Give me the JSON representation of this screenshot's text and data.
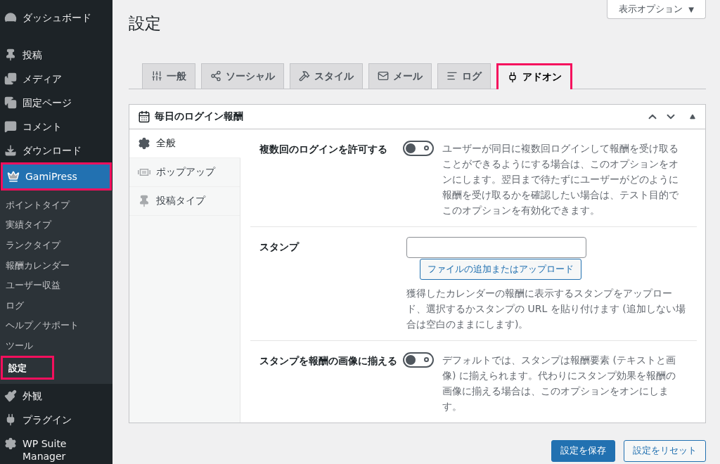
{
  "sidebar": {
    "items": [
      {
        "label": "ダッシュボード",
        "selected": false,
        "highlighted": false
      },
      {
        "label": "投稿",
        "selected": false,
        "highlighted": false
      },
      {
        "label": "メディア",
        "selected": false,
        "highlighted": false
      },
      {
        "label": "固定ページ",
        "selected": false,
        "highlighted": false
      },
      {
        "label": "コメント",
        "selected": false,
        "highlighted": false
      },
      {
        "label": "ダウンロード",
        "selected": false,
        "highlighted": false
      },
      {
        "label": "GamiPress",
        "selected": true,
        "highlighted": true,
        "children": [
          {
            "label": "ポイントタイプ",
            "selected": false,
            "highlighted": false
          },
          {
            "label": "実績タイプ",
            "selected": false,
            "highlighted": false
          },
          {
            "label": "ランクタイプ",
            "selected": false,
            "highlighted": false
          },
          {
            "label": "報酬カレンダー",
            "selected": false,
            "highlighted": false
          },
          {
            "label": "ユーザー収益",
            "selected": false,
            "highlighted": false
          },
          {
            "label": "ログ",
            "selected": false,
            "highlighted": false
          },
          {
            "label": "ヘルプ／サポート",
            "selected": false,
            "highlighted": false
          },
          {
            "label": "ツール",
            "selected": false,
            "highlighted": false
          },
          {
            "label": "設定",
            "selected": true,
            "highlighted": true
          }
        ]
      },
      {
        "label": "外観",
        "selected": false,
        "highlighted": false
      },
      {
        "label": "プラグイン",
        "selected": false,
        "highlighted": false
      },
      {
        "label": "WP Suite Manager",
        "selected": false,
        "highlighted": false
      }
    ]
  },
  "screen_options": {
    "label": "表示オプション",
    "caret": "▼"
  },
  "page_title": "設定",
  "tabs": [
    {
      "label": "一般",
      "selected": false,
      "highlighted": false
    },
    {
      "label": "ソーシャル",
      "selected": false,
      "highlighted": false
    },
    {
      "label": "スタイル",
      "selected": false,
      "highlighted": false
    },
    {
      "label": "メール",
      "selected": false,
      "highlighted": false
    },
    {
      "label": "ログ",
      "selected": false,
      "highlighted": false
    },
    {
      "label": "アドオン",
      "selected": true,
      "highlighted": true
    }
  ],
  "panel": {
    "title": "毎日のログイン報酬",
    "vertical_tabs": [
      {
        "label": "全般",
        "selected": true
      },
      {
        "label": "ポップアップ",
        "selected": false
      },
      {
        "label": "投稿タイプ",
        "selected": false
      }
    ],
    "fields": [
      {
        "kind": "toggle",
        "label": "複数回のログインを許可する",
        "on": false,
        "description": "ユーザーが同日に複数回ログインして報酬を受け取ることができるようにする場合は、このオプションをオンにします。翌日まで待たずにユーザーがどのように報酬を受け取るかを確認したい場合は、テスト目的でこのオプションを有効化できます。"
      },
      {
        "kind": "upload",
        "label": "スタンプ",
        "button": "ファイルの追加またはアップロード",
        "description": "獲得したカレンダーの報酬に表示するスタンプをアップロード、選択するかスタンプの URL を貼り付けます (追加しない場合は空白のままにします)。"
      },
      {
        "kind": "toggle",
        "label": "スタンプを報酬の画像に揃える",
        "on": false,
        "description": "デフォルトでは、スタンプは報酬要素 (テキストと画像) に揃えられます。代わりにスタンプ効果を報酬の画像に揃える場合は、このオプションをオンにします。"
      }
    ]
  },
  "buttons": [
    {
      "label": "設定を保存",
      "kind": "primary"
    },
    {
      "label": "設定をリセット",
      "kind": "secondary"
    }
  ]
}
